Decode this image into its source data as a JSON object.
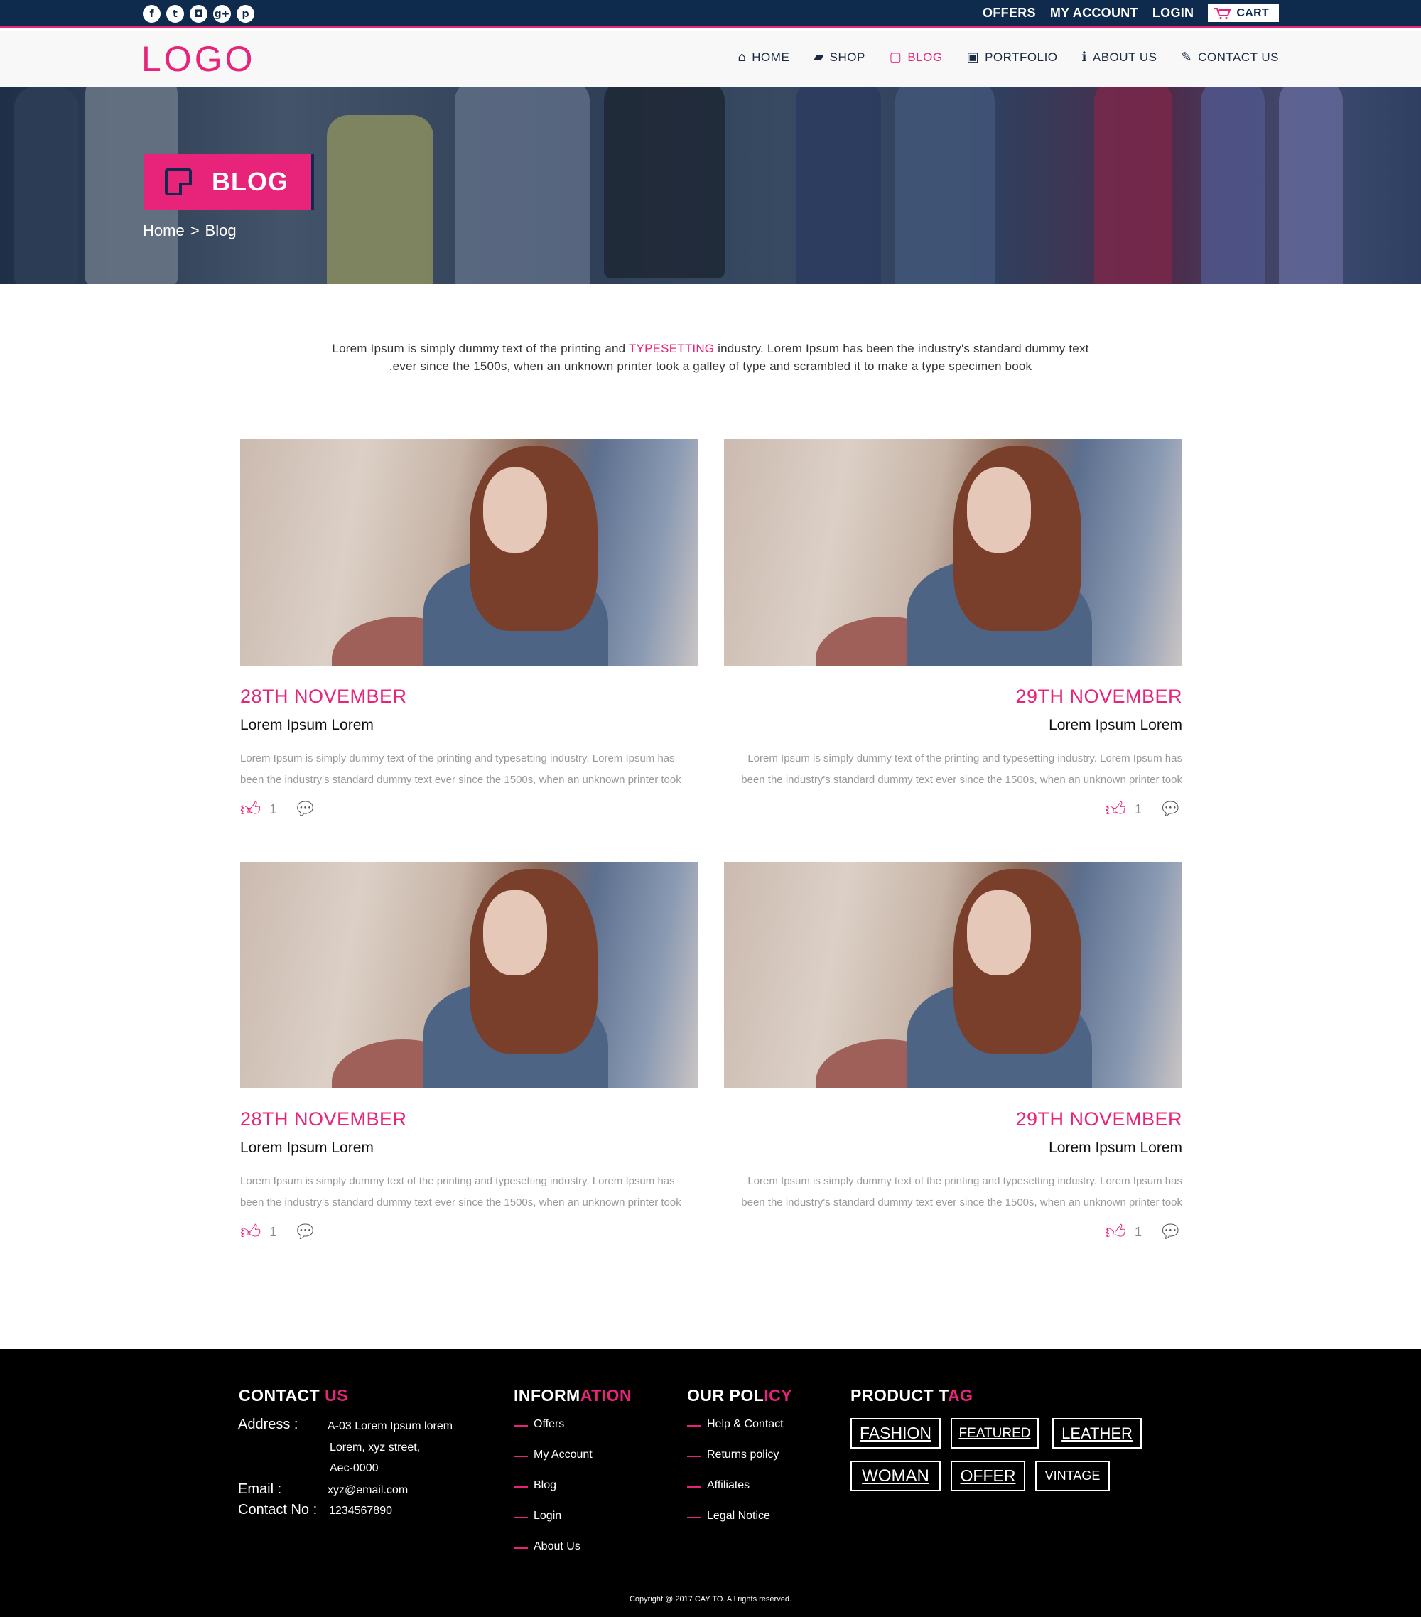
{
  "topbar": {
    "social": [
      "f",
      "t",
      "◘",
      "g+",
      "p"
    ],
    "links": [
      "OFFERS",
      "MY ACCOUNT",
      "LOGIN"
    ],
    "cart_label": "CART"
  },
  "header": {
    "logo": "LOGO",
    "nav": [
      {
        "label": "HOME",
        "icon": "home-icon"
      },
      {
        "label": "SHOP",
        "icon": "shop-icon"
      },
      {
        "label": "BLOG",
        "icon": "note-icon",
        "active": true
      },
      {
        "label": "PORTFOLIO",
        "icon": "image-icon"
      },
      {
        "label": "ABOUT US",
        "icon": "info-icon"
      },
      {
        "label": "CONTACT US",
        "icon": "pen-icon"
      }
    ]
  },
  "hero": {
    "badge": "BLOG",
    "breadcrumb_home": "Home",
    "breadcrumb_sep": ">",
    "breadcrumb_current": "Blog"
  },
  "intro": {
    "part1": "Lorem Ipsum is simply dummy text of the printing and",
    "highlight": "TYPESETTING",
    "part2": "industry. Lorem Ipsum has been the industry's standard dummy text",
    "line2": ".ever since the 1500s, when an unknown printer took a galley of type and scrambled it to make a type specimen book"
  },
  "posts": [
    {
      "date": "28TH NOVEMBER",
      "title": "Lorem Ipsum Lorem",
      "excerpt1": "Lorem Ipsum is simply dummy text of the printing and typesetting industry. Lorem Ipsum has",
      "excerpt2": "been the industry's standard dummy text ever since the 1500s, when an unknown printer took",
      "likes": "1"
    },
    {
      "date": "29TH NOVEMBER",
      "title": "Lorem Ipsum Lorem",
      "excerpt1": "Lorem Ipsum is simply dummy text of the printing and typesetting industry. Lorem Ipsum has",
      "excerpt2": "been the industry's standard dummy text ever since the 1500s, when an unknown printer took",
      "likes": "1"
    },
    {
      "date": "28TH NOVEMBER",
      "title": "Lorem Ipsum Lorem",
      "excerpt1": "Lorem Ipsum is simply dummy text of the printing and typesetting industry. Lorem Ipsum has",
      "excerpt2": "been the industry's standard dummy text ever since the 1500s, when an unknown printer took",
      "likes": "1"
    },
    {
      "date": "29TH NOVEMBER",
      "title": "Lorem Ipsum Lorem",
      "excerpt1": "Lorem Ipsum is simply dummy text of the printing and typesetting industry. Lorem Ipsum has",
      "excerpt2": "been the industry's standard dummy text ever since the 1500s, when an unknown printer took",
      "likes": "1"
    }
  ],
  "footer": {
    "contact": {
      "heading_a": "CONTACT ",
      "heading_b": "US",
      "address_label": "Address :",
      "address_lines": [
        "A-03 Lorem Ipsum lorem",
        "Lorem, xyz street,",
        "Aec-0000"
      ],
      "email_label": "Email :",
      "email": "xyz@email.com",
      "phone_label": "Contact No :",
      "phone": "1234567890"
    },
    "information": {
      "heading_a": "INFORM",
      "heading_b": "ATION",
      "items": [
        "Offers",
        "My Account",
        "Blog",
        "Login",
        "About Us"
      ]
    },
    "policy": {
      "heading_a": "OUR POL",
      "heading_b": "ICY",
      "items": [
        "Help & Contact",
        "Returns policy",
        "Affiliates",
        "Legal Notice"
      ]
    },
    "tags": {
      "heading_a": "PRODUCT T",
      "heading_b": "AG",
      "items": [
        "FASHION",
        "FEATURED",
        "LEATHER",
        "WOMAN",
        "OFFER",
        "VINTAGE"
      ]
    },
    "copyright": "Copyright @ 2017 CAY TO. All rights reserved."
  },
  "colors": {
    "accent": "#e8247a",
    "navy": "#0e2a4c",
    "footer_bg": "#000000"
  }
}
